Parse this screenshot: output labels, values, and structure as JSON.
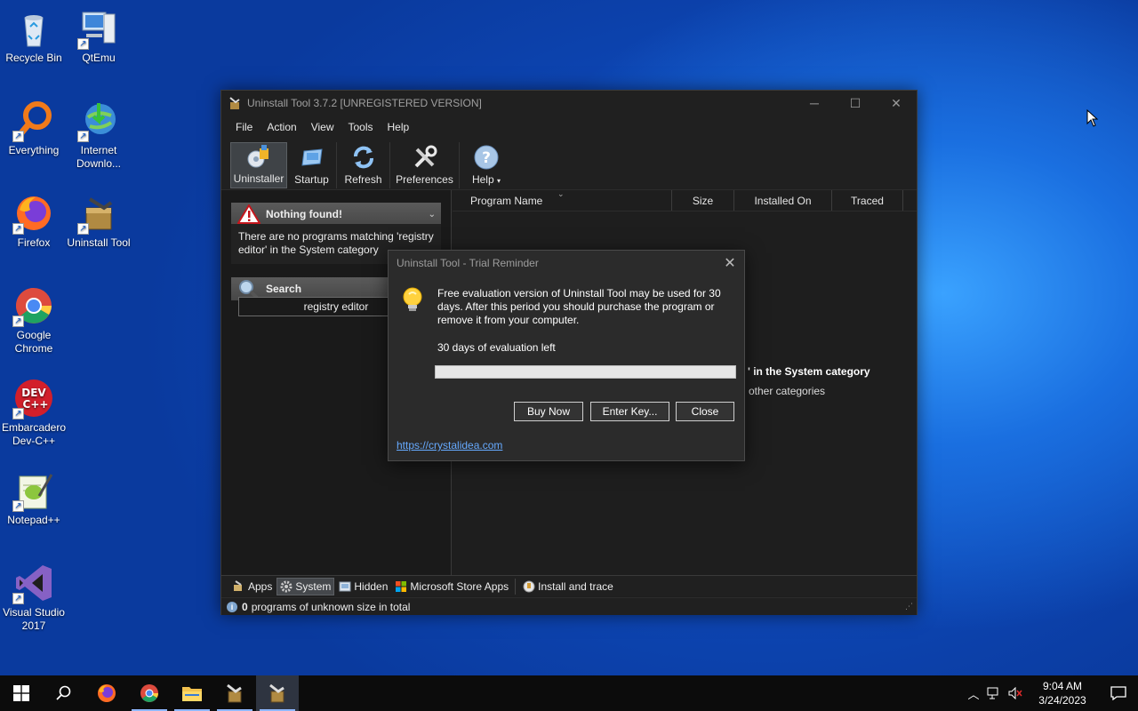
{
  "desktop_icons": [
    {
      "name": "recycle-bin",
      "label": "Recycle Bin"
    },
    {
      "name": "qtemu",
      "label": "QtEmu"
    },
    {
      "name": "everything",
      "label": "Everything"
    },
    {
      "name": "internet-download",
      "label": "Internet Downlo..."
    },
    {
      "name": "firefox",
      "label": "Firefox"
    },
    {
      "name": "uninstall-tool",
      "label": "Uninstall Tool"
    },
    {
      "name": "google-chrome",
      "label": "Google Chrome"
    },
    {
      "name": "embarcadero",
      "label": "Embarcadero Dev-C++"
    },
    {
      "name": "notepadpp",
      "label": "Notepad++"
    },
    {
      "name": "visual-studio",
      "label": "Visual Studio 2017"
    }
  ],
  "window": {
    "title": "Uninstall Tool 3.7.2 [UNREGISTERED VERSION]",
    "menu": [
      "File",
      "Action",
      "View",
      "Tools",
      "Help"
    ],
    "toolbar": {
      "uninstaller": "Uninstaller",
      "startup": "Startup",
      "refresh": "Refresh",
      "preferences": "Preferences",
      "help": "Help"
    },
    "left": {
      "nothing_found_title": "Nothing found!",
      "nothing_found_text": "There are no programs matching 'registry editor' in the System category",
      "search_title": "Search",
      "search_value": "registry editor"
    },
    "columns": {
      "program_name": "Program Name",
      "size": "Size",
      "installed_on": "Installed On",
      "traced": "Traced"
    },
    "list_empty": {
      "line1": "' in the System category",
      "line2": "other categories"
    },
    "tabs": {
      "apps": "Apps",
      "system": "System",
      "hidden": "Hidden",
      "store": "Microsoft Store Apps",
      "install_trace": "Install and trace"
    },
    "status": {
      "count": "0",
      "text": "programs of unknown size in total"
    }
  },
  "dialog": {
    "title": "Uninstall Tool - Trial Reminder",
    "message": "Free evaluation version of Uninstall Tool may be used for 30 days. After this period you should purchase the program or remove it from your computer.",
    "days_left": "30 days of evaluation left",
    "progress_used_fraction": 0,
    "buttons": {
      "buy": "Buy Now",
      "key": "Enter Key...",
      "close": "Close"
    },
    "link": "https://crystalidea.com"
  },
  "taskbar": {
    "time": "9:04 AM",
    "date": "3/24/2023"
  },
  "colors": {
    "desktop_accent": "#1a6fe0",
    "window_bg": "#1e1e1e",
    "dialog_bg": "#2b2b2b",
    "link": "#66aaff"
  }
}
